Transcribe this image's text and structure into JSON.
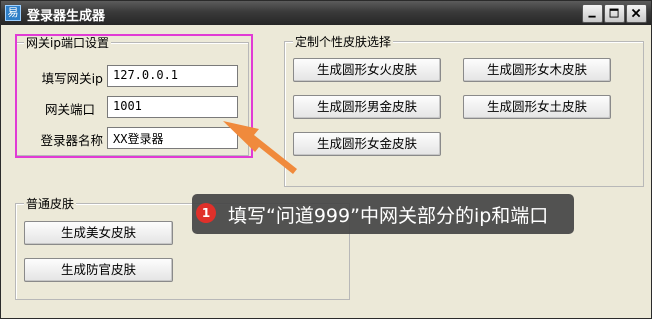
{
  "window": {
    "title": "登录器生成器",
    "icon": "app-icon",
    "controls": [
      "minimize-icon",
      "maximize-icon",
      "close-icon"
    ]
  },
  "gateway_group": {
    "title": "网关ip端口设置",
    "fields": [
      {
        "label": "填写网关ip",
        "value": "127.0.0.1"
      },
      {
        "label": "网关端口",
        "value": "1001"
      },
      {
        "label": "登录器名称",
        "value": "XX登录器"
      }
    ]
  },
  "skin_group": {
    "title": "定制个性皮肤选择",
    "buttons": [
      "生成圆形女火皮肤",
      "生成圆形女木皮肤",
      "生成圆形男金皮肤",
      "生成圆形女土皮肤",
      "生成圆形女金皮肤"
    ]
  },
  "normal_group": {
    "title": "普通皮肤",
    "buttons": [
      "生成美女皮肤",
      "生成防官皮肤"
    ]
  },
  "annotation": {
    "number": "1",
    "text": "填写“问道999”中网关部分的ip和端口",
    "arrow_color": "#f08a3c",
    "highlight_color": "#e13bd5"
  }
}
